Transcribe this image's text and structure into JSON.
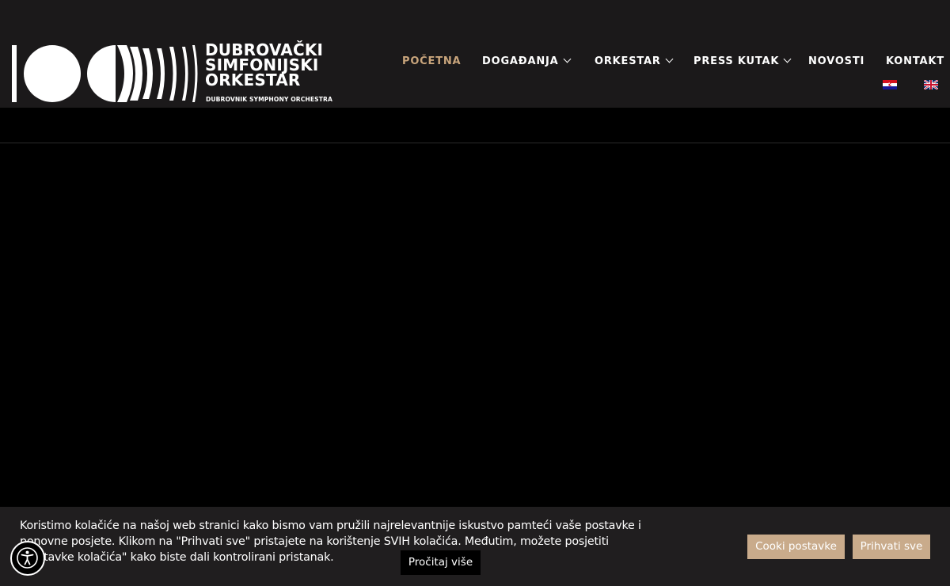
{
  "header": {
    "logo": {
      "line1": "DUBROVAČKI",
      "line2": "SIMFONIJSKI",
      "line3": "ORKESTAR",
      "subtitle": "DUBROVNIK SYMPHONY ORCHESTRA"
    },
    "nav": [
      {
        "label": "POČETNA",
        "active": true
      },
      {
        "label": "DOGAĐANJA",
        "has_dropdown": true
      },
      {
        "label": "ORKESTAR",
        "has_dropdown": true
      },
      {
        "label": "PRESS KUTAK",
        "has_dropdown": true
      },
      {
        "label": "NOVOSTI"
      },
      {
        "label": "KONTAKT"
      }
    ],
    "languages": [
      {
        "icon": "croatia-flag-icon"
      },
      {
        "icon": "uk-flag-icon"
      }
    ]
  },
  "cookie_banner": {
    "text": "Koristimo kolačiće na našoj web stranici kako bismo vam pružili najrelevantnije iskustvo pamteći vaše postavke i ponovne posjete. Klikom na \"Prihvati sve\" pristajete na korištenje SVIH kolačića. Međutim, možete posjetiti \"Postavke kolačića\" kako biste dali kontrolirani pristanak.",
    "read_more": "Pročitaj više",
    "settings_button": "Cooki postavke",
    "accept_button": "Prihvati sve"
  },
  "accessibility": {
    "icon": "accessibility-icon"
  },
  "colors": {
    "header_bg": "#1b191a",
    "accent": "#c9a57c",
    "button_bg": "#c9ab8b",
    "page_bg": "#000000"
  }
}
